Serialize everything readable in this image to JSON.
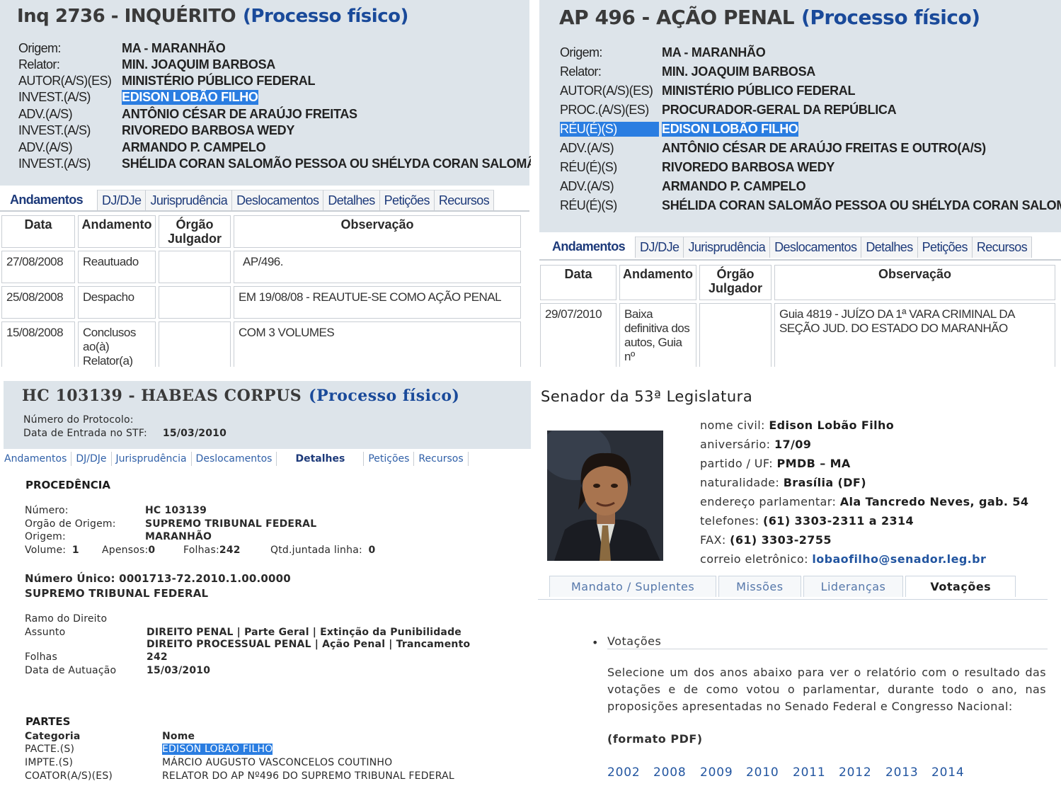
{
  "inq": {
    "title": "Inq 2736 - INQUÉRITO",
    "fisico": "(Processo físico)",
    "rows": [
      {
        "label": "Origem:",
        "value": "MA - MARANHÃO"
      },
      {
        "label": "Relator:",
        "value": "MIN. JOAQUIM BARBOSA"
      },
      {
        "label": "AUTOR(A/S)(ES)",
        "value": "MINISTÉRIO PÚBLICO FEDERAL"
      },
      {
        "label": "INVEST.(A/S)",
        "value": "EDISON LOBÃO FILHO"
      },
      {
        "label": "ADV.(A/S)",
        "value": "ANTÔNIO CÉSAR DE ARAÚJO FREITAS"
      },
      {
        "label": "INVEST.(A/S)",
        "value": "RIVOREDO BARBOSA WEDY"
      },
      {
        "label": "ADV.(A/S)",
        "value": "ARMANDO P. CAMPELO"
      },
      {
        "label": "INVEST.(A/S)",
        "value": "SHÉLIDA CORAN SALOMÃO PESSOA OU SHÉLYDA CORAN SALOMÃO"
      }
    ],
    "tabs": [
      "Andamentos",
      "DJ/DJe",
      "Jurisprudência",
      "Deslocamentos",
      "Detalhes",
      "Petições",
      "Recursos"
    ],
    "headers": [
      "Data",
      "Andamento",
      "Órgão Julgador",
      "Observação"
    ],
    "andamentos": [
      {
        "data": "27/08/2008",
        "andamento": "Reautuado",
        "orgao": "",
        "obs": "AP/496."
      },
      {
        "data": "25/08/2008",
        "andamento": "Despacho",
        "orgao": "",
        "obs": "EM 19/08/08 - REAUTUE-SE COMO AÇÃO PENAL"
      },
      {
        "data": "15/08/2008",
        "andamento": "Conclusos ao(à) Relator(a)",
        "orgao": "",
        "obs": "COM 3 VOLUMES"
      }
    ]
  },
  "ap": {
    "title": "AP 496 - AÇÃO PENAL",
    "fisico": "(Processo físico)",
    "rows": [
      {
        "label": "Origem:",
        "value": "MA - MARANHÃO"
      },
      {
        "label": "Relator:",
        "value": "MIN. JOAQUIM BARBOSA"
      },
      {
        "label": "AUTOR(A/S)(ES)",
        "value": "MINISTÉRIO PÚBLICO FEDERAL"
      },
      {
        "label": "PROC.(A/S)(ES)",
        "value": "PROCURADOR-GERAL DA REPÚBLICA"
      },
      {
        "label": "RÉU(É)(S)",
        "value": "EDISON LOBÃO FILHO"
      },
      {
        "label": "ADV.(A/S)",
        "value": "ANTÔNIO CÉSAR DE ARAÚJO FREITAS E OUTRO(A/S)"
      },
      {
        "label": "RÉU(É)(S)",
        "value": "RIVOREDO BARBOSA WEDY"
      },
      {
        "label": "ADV.(A/S)",
        "value": "ARMANDO P. CAMPELO"
      },
      {
        "label": "RÉU(É)(S)",
        "value": "SHÉLIDA CORAN SALOMÃO PESSOA OU SHÉLYDA CORAN SALOMÃO"
      }
    ],
    "tabs": [
      "Andamentos",
      "DJ/DJe",
      "Jurisprudência",
      "Deslocamentos",
      "Detalhes",
      "Petições",
      "Recursos"
    ],
    "headers": [
      "Data",
      "Andamento",
      "Órgão Julgador",
      "Observação"
    ],
    "andamentos": [
      {
        "data": "29/07/2010",
        "andamento": "Baixa definitiva dos autos, Guia nº",
        "orgao": "",
        "obs": "Guia 4819 - JUÍZO DA 1ª VARA CRIMINAL DA SEÇÃO JUD. DO ESTADO DO MARANHÃO"
      }
    ]
  },
  "hc": {
    "title": "HC 103139 - HABEAS CORPUS",
    "fisico": "(Processo físico)",
    "protocolo_label": "Número do Protocolo:",
    "entrada_label": "Data de Entrada no STF:",
    "entrada_value": "15/03/2010",
    "tabs": [
      "Andamentos",
      "DJ/DJe",
      "Jurisprudência",
      "Deslocamentos",
      "Detalhes",
      "Petições",
      "Recursos"
    ],
    "procedencia_title": "PROCEDÊNCIA",
    "numero_label": "Número:",
    "numero_value": "HC 103139",
    "orgao_label": "Orgão de Origem:",
    "orgao_value": "SUPREMO TRIBUNAL FEDERAL",
    "origem_label": "Origem:",
    "origem_value": "MARANHÃO",
    "volume_label": "Volume:",
    "volume_value": "1",
    "apensos_label": "Apensos:",
    "apensos_value": "0",
    "folhas_label": "Folhas:",
    "folhas_value": "242",
    "qtd_label": "Qtd.juntada linha:",
    "qtd_value": "0",
    "numero_unico": "Número Único: 0001713-72.2010.1.00.0000",
    "tribunal": "SUPREMO TRIBUNAL FEDERAL",
    "ramo_label": "Ramo do Direito",
    "assunto_label": "Assunto",
    "assunto_1": "DIREITO PENAL | Parte Geral | Extinção da Punibilidade",
    "assunto_2": "DIREITO PROCESSUAL PENAL | Ação Penal | Trancamento",
    "folhas2_label": "Folhas",
    "folhas2_value": "242",
    "autuacao_label": "Data de Autuação",
    "autuacao_value": "15/03/2010",
    "partes_title": "PARTES",
    "categoria_header": "Categoria",
    "nome_header": "Nome",
    "partes": [
      {
        "categoria": "PACTE.(S)",
        "nome": "EDISON LOBÃO FILHO"
      },
      {
        "categoria": "IMPTE.(S)",
        "nome": "MÁRCIO AUGUSTO VASCONCELOS COUTINHO"
      },
      {
        "categoria": "COATOR(A/S)(ES)",
        "nome": "RELATOR DO AP Nº496 DO SUPREMO TRIBUNAL FEDERAL"
      }
    ]
  },
  "senador": {
    "title": "Senador da 53ª Legislatura",
    "fields": [
      {
        "label": "nome civil:",
        "value": "Edison Lobão Filho"
      },
      {
        "label": "aniversário:",
        "value": "17/09"
      },
      {
        "label": "partido / UF:",
        "value": "PMDB – MA"
      },
      {
        "label": "naturalidade:",
        "value": "Brasília (DF)"
      },
      {
        "label": "endereço parlamentar:",
        "value": "Ala Tancredo Neves, gab. 54"
      },
      {
        "label": "telefones:",
        "value": "(61) 3303-2311 a 2314"
      },
      {
        "label": "FAX:",
        "value": "(61) 3303-2755"
      }
    ],
    "email_label": "correio eletrônico:",
    "email_value": "lobaofilho@senador.leg.br",
    "tabs": [
      "Mandato / Suplentes",
      "Missões",
      "Lideranças",
      "Votações"
    ],
    "votacoes_heading": "Votações",
    "votacoes_text": "Selecione um dos anos abaixo para ver o relatório com o resultado das votações e de como votou o parlamentar, durante todo o ano, nas proposições apresentadas no Senado Federal e Congresso Nacional:",
    "formato": "(formato PDF)",
    "years": [
      "2002",
      "2008",
      "2009",
      "2010",
      "2011",
      "2012",
      "2013",
      "2014"
    ]
  }
}
